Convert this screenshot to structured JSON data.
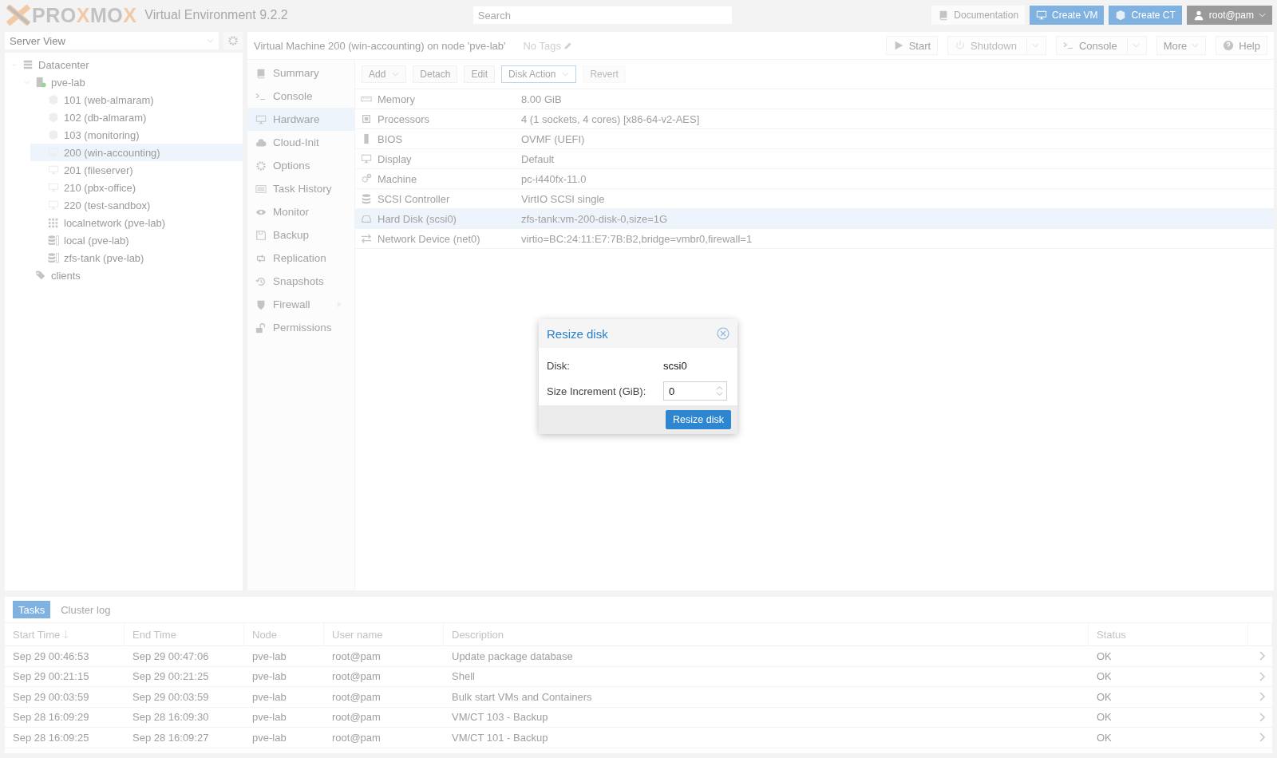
{
  "header": {
    "logo": "PROXMOX",
    "version": "Virtual Environment 9.2.2",
    "search": {
      "placeholder": "Search"
    },
    "buttons": [
      {
        "label": "Documentation",
        "kind": "plain"
      },
      {
        "label": "Create VM",
        "kind": "primary"
      },
      {
        "label": "Create CT",
        "kind": "primary"
      },
      {
        "label": "root@pam",
        "kind": "user"
      }
    ]
  },
  "view_selector": {
    "value": "Server View"
  },
  "tree": [
    {
      "label": "Datacenter",
      "kind": "datacenter",
      "selected": false,
      "expanded": true,
      "children": [
        {
          "label": "pve-lab",
          "kind": "node",
          "selected": false,
          "expanded": true,
          "children": [
            {
              "label": "101 (web-almaram)",
              "kind": "ct",
              "selected": false
            },
            {
              "label": "102 (db-almaram)",
              "kind": "ct",
              "selected": false
            },
            {
              "label": "103 (monitoring)",
              "kind": "ct",
              "selected": false
            },
            {
              "label": "200 (win-accounting)",
              "kind": "vm",
              "selected": true
            },
            {
              "label": "201 (fileserver)",
              "kind": "vm",
              "selected": false
            },
            {
              "label": "210 (pbx-office)",
              "kind": "vm",
              "selected": false
            },
            {
              "label": "220 (test-sandbox)",
              "kind": "vm",
              "selected": false
            },
            {
              "label": "localnetwork (pve-lab)",
              "kind": "sdn",
              "selected": false
            },
            {
              "label": "local (pve-lab)",
              "kind": "storage",
              "selected": false
            },
            {
              "label": "zfs-tank (pve-lab)",
              "kind": "storage",
              "selected": false
            }
          ]
        },
        {
          "label": "clients",
          "kind": "pool",
          "selected": false
        }
      ]
    }
  ],
  "content_header": {
    "title": "Virtual Machine 200 (win-accounting) on node 'pve-lab'",
    "tags": "No Tags",
    "buttons": [
      {
        "label": "Start",
        "kind": "plain",
        "disabled": false
      },
      {
        "label": "Shutdown",
        "kind": "split",
        "disabled": true
      },
      {
        "label": "Console",
        "kind": "split",
        "disabled": false
      },
      {
        "label": "More",
        "kind": "menu",
        "disabled": false
      },
      {
        "label": "Help",
        "kind": "plain",
        "disabled": false
      }
    ]
  },
  "nav": [
    {
      "label": "Summary",
      "selected": false,
      "submenu": false
    },
    {
      "label": "Console",
      "selected": false,
      "submenu": false
    },
    {
      "label": "Hardware",
      "selected": true,
      "submenu": false
    },
    {
      "label": "Cloud-Init",
      "selected": false,
      "submenu": false
    },
    {
      "label": "Options",
      "selected": false,
      "submenu": false
    },
    {
      "label": "Task History",
      "selected": false,
      "submenu": false
    },
    {
      "label": "Monitor",
      "selected": false,
      "submenu": false
    },
    {
      "label": "Backup",
      "selected": false,
      "submenu": false
    },
    {
      "label": "Replication",
      "selected": false,
      "submenu": false
    },
    {
      "label": "Snapshots",
      "selected": false,
      "submenu": false
    },
    {
      "label": "Firewall",
      "selected": false,
      "submenu": true
    },
    {
      "label": "Permissions",
      "selected": false,
      "submenu": false
    }
  ],
  "toolbar": [
    {
      "label": "Add",
      "menu": true,
      "disabled": false,
      "active": false
    },
    {
      "label": "Detach",
      "menu": false,
      "disabled": false,
      "active": false
    },
    {
      "label": "Edit",
      "menu": false,
      "disabled": false,
      "active": false
    },
    {
      "label": "Disk Action",
      "menu": true,
      "disabled": false,
      "active": true
    },
    {
      "label": "Revert",
      "menu": false,
      "disabled": true,
      "active": false
    }
  ],
  "hardware": [
    {
      "label": "Memory",
      "value": "8.00 GiB",
      "selected": false
    },
    {
      "label": "Processors",
      "value": "4 (1 sockets, 4 cores) [x86-64-v2-AES]",
      "selected": false
    },
    {
      "label": "BIOS",
      "value": "OVMF (UEFI)",
      "selected": false
    },
    {
      "label": "Display",
      "value": "Default",
      "selected": false
    },
    {
      "label": "Machine",
      "value": "pc-i440fx-11.0",
      "selected": false
    },
    {
      "label": "SCSI Controller",
      "value": "VirtIO SCSI single",
      "selected": false
    },
    {
      "label": "Hard Disk (scsi0)",
      "value": "zfs-tank:vm-200-disk-0,size=1G",
      "selected": true
    },
    {
      "label": "Network Device (net0)",
      "value": "virtio=BC:24:11:E7:7B:B2,bridge=vmbr0,firewall=1",
      "selected": false
    }
  ],
  "dialog": {
    "title": "Resize disk",
    "fields": [
      {
        "label": "Disk:",
        "kind": "display",
        "value": "scsi0"
      },
      {
        "label": "Size Increment (GiB):",
        "kind": "number",
        "value": "0"
      }
    ],
    "submit": "Resize disk"
  },
  "tasks": {
    "tabs": [
      {
        "label": "Tasks",
        "selected": true
      },
      {
        "label": "Cluster log",
        "selected": false
      }
    ],
    "columns": [
      {
        "label": "Start Time",
        "sorted": true
      },
      {
        "label": "End Time",
        "sorted": false
      },
      {
        "label": "Node",
        "sorted": false
      },
      {
        "label": "User name",
        "sorted": false
      },
      {
        "label": "Description",
        "sorted": false
      },
      {
        "label": "Status",
        "sorted": false
      }
    ],
    "rows": [
      [
        "Sep 29 00:46:53",
        "Sep 29 00:47:06",
        "pve-lab",
        "root@pam",
        "Update package database",
        "OK"
      ],
      [
        "Sep 29 00:21:15",
        "Sep 29 00:21:25",
        "pve-lab",
        "root@pam",
        "Shell",
        "OK"
      ],
      [
        "Sep 29 00:03:59",
        "Sep 29 00:03:59",
        "pve-lab",
        "root@pam",
        "Bulk start VMs and Containers",
        "OK"
      ],
      [
        "Sep 28 16:09:29",
        "Sep 28 16:09:30",
        "pve-lab",
        "root@pam",
        "VM/CT 103 - Backup",
        "OK"
      ],
      [
        "Sep 28 16:09:25",
        "Sep 28 16:09:27",
        "pve-lab",
        "root@pam",
        "VM/CT 101 - Backup",
        "OK"
      ]
    ]
  }
}
